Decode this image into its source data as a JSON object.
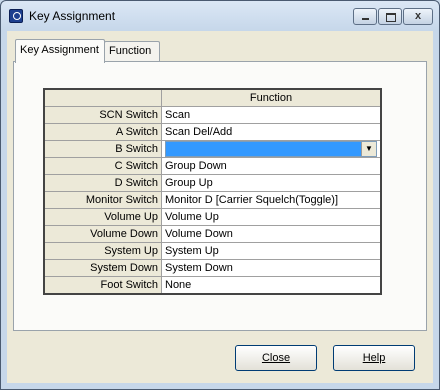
{
  "window": {
    "title": "Key Assignment",
    "close_glyph": "x"
  },
  "tabs": [
    {
      "label": "Key Assignment",
      "active": true
    },
    {
      "label": "Function",
      "active": false
    }
  ],
  "table": {
    "header_function": "Function",
    "rows": [
      {
        "key": "SCN Switch",
        "function": "Scan"
      },
      {
        "key": "A Switch",
        "function": "Scan Del/Add"
      },
      {
        "key": "B Switch",
        "function": ""
      },
      {
        "key": "C Switch",
        "function": "Group Down"
      },
      {
        "key": "D Switch",
        "function": "Group Up"
      },
      {
        "key": "Monitor Switch",
        "function": "Monitor D [Carrier Squelch(Toggle)]"
      },
      {
        "key": "Volume Up",
        "function": "Volume Up"
      },
      {
        "key": "Volume Down",
        "function": "Volume Down"
      },
      {
        "key": "System Up",
        "function": "System Up"
      },
      {
        "key": "System Down",
        "function": "System Down"
      },
      {
        "key": "Foot Switch",
        "function": "None"
      }
    ]
  },
  "buttons": {
    "close": "Close",
    "help": "Help"
  },
  "icons": {
    "app": "radio-app-icon",
    "dropdown": "chevron-down-icon"
  }
}
